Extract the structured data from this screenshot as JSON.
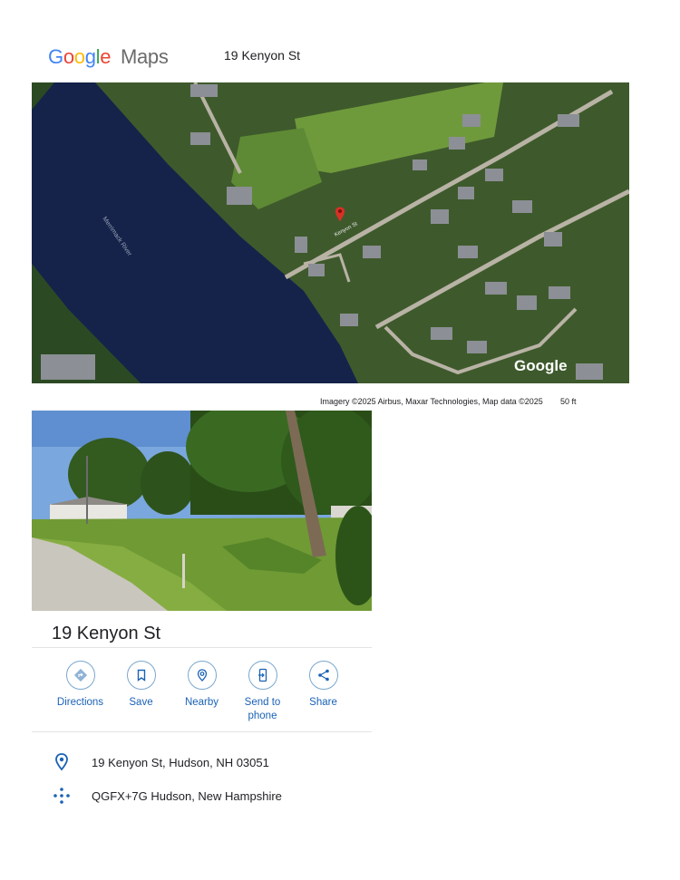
{
  "header": {
    "logo_google": "Google",
    "logo_maps": "Maps",
    "title": "19 Kenyon St"
  },
  "map": {
    "watermark": "Google",
    "credit": "Imagery ©2025 Airbus, Maxar Technologies, Map data ©2025",
    "scale": "50 ft",
    "water_label": "Merrimack River",
    "road_label": "Kenyon St"
  },
  "place": {
    "title": "19 Kenyon St"
  },
  "actions": [
    {
      "label": "Directions",
      "icon": "directions-icon"
    },
    {
      "label": "Save",
      "icon": "bookmark-icon"
    },
    {
      "label": "Nearby",
      "icon": "nearby-icon"
    },
    {
      "label": "Send to phone",
      "icon": "send-to-phone-icon"
    },
    {
      "label": "Share",
      "icon": "share-icon"
    }
  ],
  "details": {
    "address": "19 Kenyon St, Hudson, NH 03051",
    "plus_code": "QGFX+7G Hudson, New Hampshire"
  },
  "colors": {
    "accent": "#1a62b6",
    "water": "#15234a",
    "vegetation": "#3d5a2a",
    "pin": "#d93025"
  }
}
